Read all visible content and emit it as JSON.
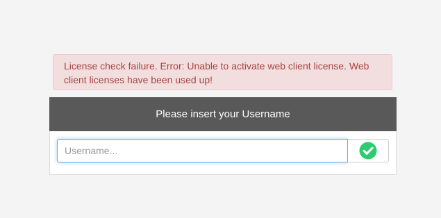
{
  "alert": {
    "message": "License check failure. Error: Unable to activate web client license. Web client licenses have been used up!"
  },
  "login": {
    "title": "Please insert your Username",
    "username_placeholder": "Username...",
    "username_value": "",
    "submit_icon": "check-circle-icon",
    "submit_color": "#2ecc71"
  },
  "colors": {
    "alert_bg": "#f2dede",
    "alert_text": "#a94442",
    "header_bg": "#595959",
    "focus_border": "#66afe9"
  }
}
